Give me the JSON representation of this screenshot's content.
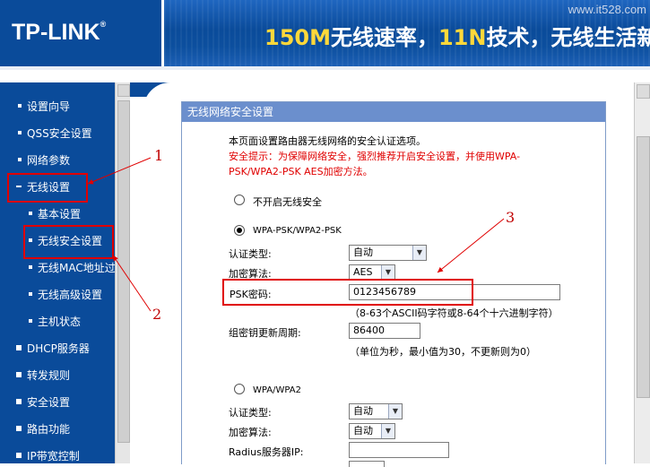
{
  "header": {
    "logo": "TP-LINK",
    "logo_reg": "®",
    "banner_part1": "150M",
    "banner_part2": "无线速率，",
    "banner_part3": "11N",
    "banner_part4": "技术，无线生活新",
    "watermark": "www.it528.com"
  },
  "sidebar": {
    "items": [
      {
        "label": "设置向导"
      },
      {
        "label": "QSS安全设置"
      },
      {
        "label": "网络参数"
      },
      {
        "label": "无线设置"
      },
      {
        "label": "基本设置"
      },
      {
        "label": "无线安全设置"
      },
      {
        "label": "无线MAC地址过滤"
      },
      {
        "label": "无线高级设置"
      },
      {
        "label": "主机状态"
      },
      {
        "label": "DHCP服务器"
      },
      {
        "label": "转发规则"
      },
      {
        "label": "安全设置"
      },
      {
        "label": "路由功能"
      },
      {
        "label": "IP带宽控制"
      }
    ]
  },
  "panel": {
    "title": "无线网络安全设置",
    "intro": "本页面设置路由器无线网络的安全认证选项。",
    "warning_line1": "安全提示：为保障网络安全，强烈推荐开启安全设置，并使用WPA-",
    "warning_line2": "PSK/WPA2-PSK AES加密方法。",
    "opt_none": "不开启无线安全",
    "opt_wpapsk": "WPA-PSK/WPA2-PSK",
    "auth_label": "认证类型:",
    "auth_value": "自动",
    "enc_label": "加密算法:",
    "enc_value": "AES",
    "psk_label": "PSK密码:",
    "psk_value": "0123456789",
    "psk_hint": "（8-63个ASCII码字符或8-64个十六进制字符）",
    "renew_label": "组密钥更新周期:",
    "renew_value": "86400",
    "renew_hint": "（单位为秒，最小值为30，不更新则为0）",
    "opt_wpa": "WPA/WPA2",
    "auth2_label": "认证类型:",
    "auth2_value": "自动",
    "enc2_label": "加密算法:",
    "enc2_value": "自动",
    "radius_label": "Radius服务器IP:"
  },
  "annotations": {
    "n1": "1",
    "n2": "2",
    "n3": "3"
  },
  "colors": {
    "brand_blue": "#0a4b9a",
    "title_bar": "#6b8fcd",
    "annotation_red": "#e00000",
    "warning_red": "#e00000"
  }
}
